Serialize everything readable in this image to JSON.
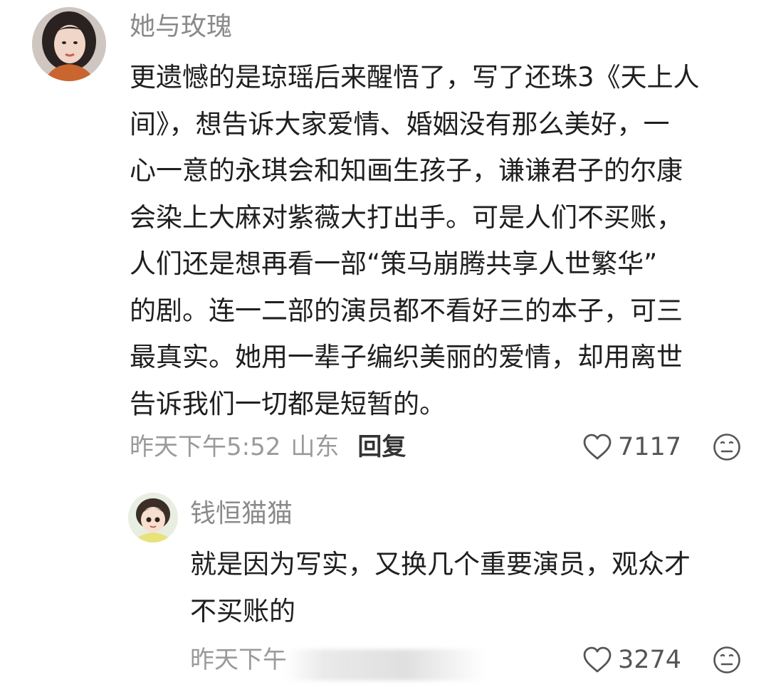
{
  "main_comment": {
    "username": "她与玫瑰",
    "lines": [
      "更遗憾的是琼瑶后来醒悟了，写了还珠3《天上人",
      "间》，想告诉大家爱情、婚姻没有那么美好，一",
      "心一意的永琪会和知画生孩子，谦谦君子的尔康",
      "会染上大麻对紫薇大打出手。可是人们不买账，",
      "人们还是想再看一部“策马崩腾共享人世繁华”",
      "的剧。连一二部的演员都不看好三的本子，可三",
      "最真实。她用一辈子编织美丽的爱情，却用离世",
      "告诉我们一切都是短暂的。"
    ],
    "time": "昨天下午5:52",
    "location": "山东",
    "reply_label": "回复",
    "likes": "7117"
  },
  "reply_comment": {
    "username": "钱恒猫猫",
    "lines": [
      "就是因为写实，又换几个重要演员，观众才",
      "不买账的"
    ],
    "time_visible": "昨天下午",
    "likes": "3274"
  },
  "icons": {
    "like": "heart-outline-icon",
    "emoji": "neutral-face-icon"
  },
  "colors": {
    "text_primary": "#1f1f1f",
    "text_secondary": "#9a9a9a",
    "username": "#8a8a8a"
  }
}
